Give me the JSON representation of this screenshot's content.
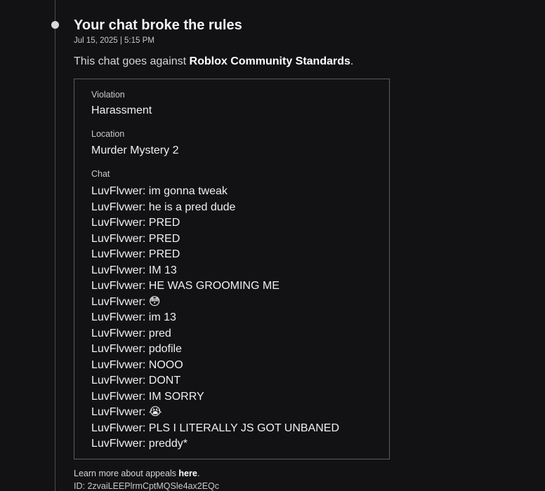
{
  "notice": {
    "title": "Your chat broke the rules",
    "timestamp": "Jul 15, 2025 | 5:15 PM",
    "description_prefix": "This chat goes against ",
    "description_link": "Roblox Community Standards",
    "description_suffix": "."
  },
  "details": {
    "violation_label": "Violation",
    "violation_value": "Harassment",
    "location_label": "Location",
    "location_value": "Murder Mystery 2",
    "chat_label": "Chat",
    "chat_lines": [
      "LuvFlvwer: im gonna tweak",
      "LuvFlvwer: he is a pred dude",
      "LuvFlvwer: PRED",
      "LuvFlvwer: PRED",
      "LuvFlvwer: PRED",
      "LuvFlvwer: IM 13",
      "LuvFlvwer: HE WAS GROOMING ME",
      "LuvFlvwer: 😳",
      "LuvFlvwer: im 13",
      "LuvFlvwer: pred",
      "LuvFlvwer: pdofile",
      "LuvFlvwer: NOOO",
      "LuvFlvwer: DONT",
      "LuvFlvwer: IM SORRY",
      "LuvFlvwer: 😭",
      "LuvFlvwer: PLS I LITERALLY JS GOT UNBANED",
      "LuvFlvwer: preddy*"
    ]
  },
  "footer": {
    "appeal_prefix": "Learn more about appeals ",
    "appeal_link": "here",
    "appeal_suffix": ".",
    "id_text": "ID: 2zvaiLEEPlrmCptMQSle4ax2EQc"
  },
  "colors": {
    "background": "#121215",
    "border": "#5c5c62",
    "timeline": "#4a4a50"
  }
}
